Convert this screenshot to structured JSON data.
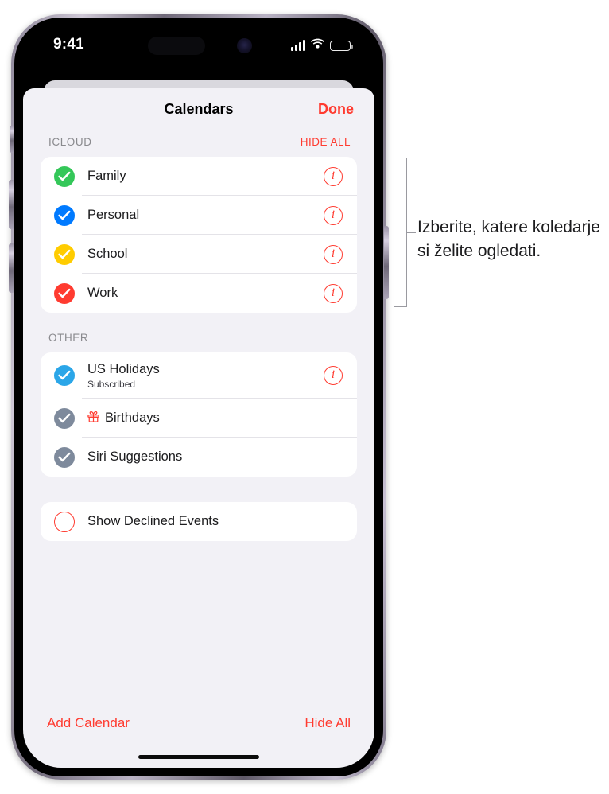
{
  "status_bar": {
    "time": "9:41",
    "signal_icon": "cellular-signal-icon",
    "wifi_icon": "wifi-icon",
    "battery_icon": "battery-icon"
  },
  "sheet": {
    "title": "Calendars",
    "done_label": "Done"
  },
  "sections": [
    {
      "id": "icloud",
      "title": "ICLOUD",
      "action_label": "HIDE ALL",
      "rows": [
        {
          "label": "Family",
          "color": "#34c759",
          "checked": true,
          "info": true
        },
        {
          "label": "Personal",
          "color": "#007aff",
          "checked": true,
          "info": true
        },
        {
          "label": "School",
          "color": "#ffcc00",
          "checked": true,
          "info": true
        },
        {
          "label": "Work",
          "color": "#ff3b30",
          "checked": true,
          "info": true
        }
      ]
    },
    {
      "id": "other",
      "title": "OTHER",
      "action_label": "",
      "rows": [
        {
          "label": "US Holidays",
          "sub": "Subscribed",
          "color": "#2ba6e8",
          "checked": true,
          "info": true
        },
        {
          "label": "Birthdays",
          "color": "#7e8a9c",
          "checked": true,
          "info": false,
          "icon": "gift-icon"
        },
        {
          "label": "Siri Suggestions",
          "color": "#7e8a9c",
          "checked": true,
          "info": false
        }
      ]
    }
  ],
  "declined": {
    "label": "Show Declined Events",
    "color": "#ff3b30",
    "checked": false
  },
  "bottom_toolbar": {
    "add_calendar_label": "Add Calendar",
    "hide_all_label": "Hide All"
  },
  "callout": {
    "text": "Izberite, katere koledarje si želite ogledati."
  }
}
